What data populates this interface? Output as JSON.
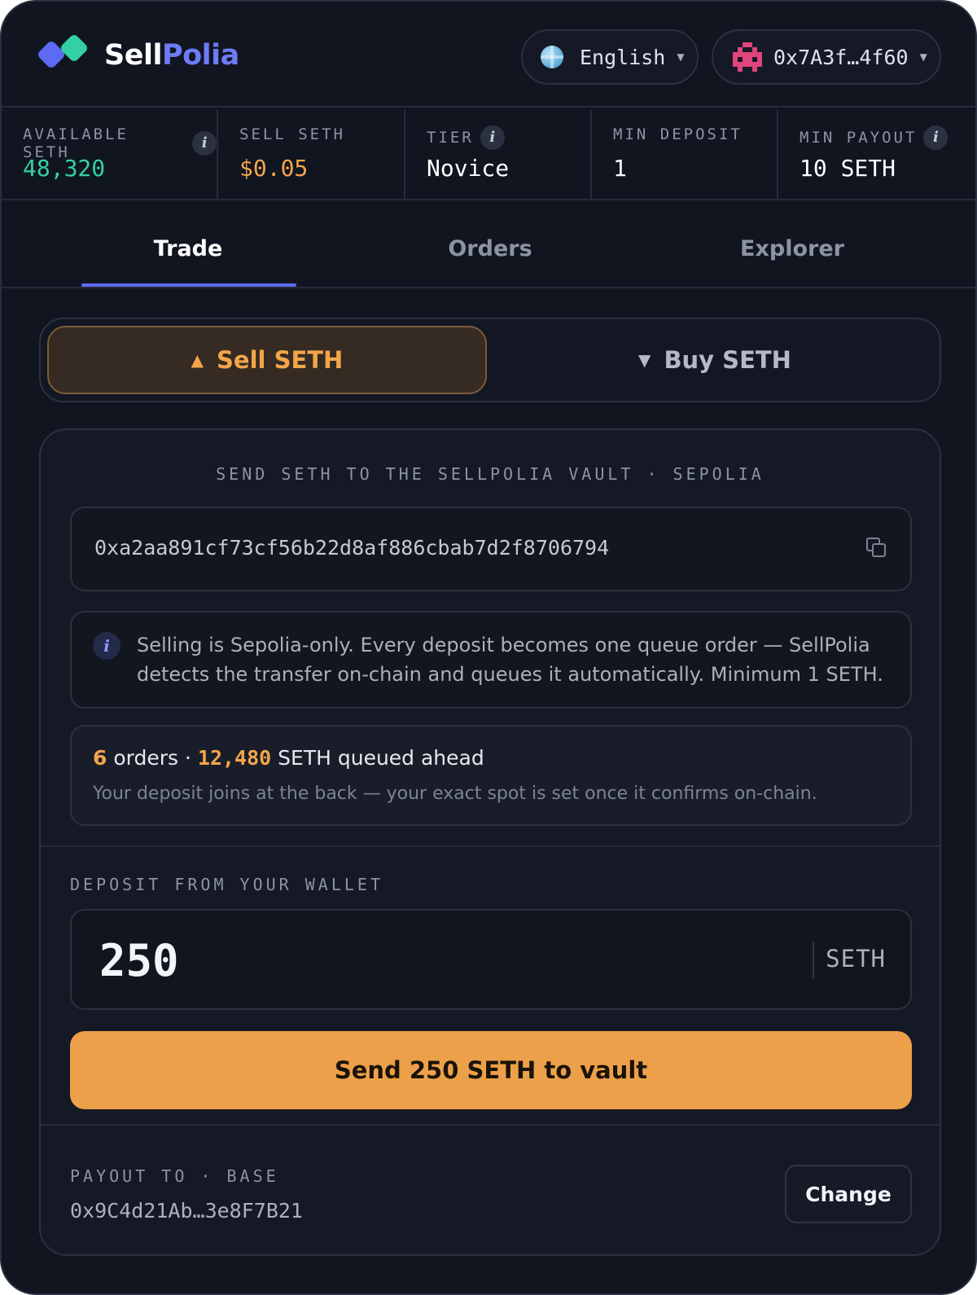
{
  "brand": {
    "part1": "Sell",
    "part2": "Polia"
  },
  "header": {
    "language": "English",
    "wallet_address": "0x7A3f…4f60"
  },
  "stats": [
    {
      "label": "AVAILABLE SETH",
      "value": "48,320",
      "has_info": true,
      "color": "#34d0a4"
    },
    {
      "label": "SELL SETH",
      "value": "$0.05",
      "has_info": false,
      "color": "#f3a54a"
    },
    {
      "label": "TIER",
      "value": "Novice",
      "has_info": true,
      "color": "#ffffff"
    },
    {
      "label": "MIN DEPOSIT",
      "value": "1",
      "has_info": false,
      "color": "#ffffff"
    },
    {
      "label": "MIN PAYOUT",
      "value": "10 SETH",
      "has_info": true,
      "color": "#ffffff"
    }
  ],
  "tabs": [
    {
      "label": "Trade",
      "active": true
    },
    {
      "label": "Orders",
      "active": false
    },
    {
      "label": "Explorer",
      "active": false
    }
  ],
  "toggle": {
    "sell_label": "Sell SETH",
    "buy_label": "Buy SETH",
    "active": "sell"
  },
  "vault": {
    "title": "SEND SETH TO THE SELLPOLIA VAULT · SEPOLIA",
    "address": "0xa2aa891cf73cf56b22d8af886cbab7d2f8706794"
  },
  "note": {
    "icon": "i",
    "text": "Selling is Sepolia-only. Every deposit becomes one queue order — SellPolia detects the transfer on-chain and queues it automatically. Minimum 1 SETH."
  },
  "queue": {
    "orders_count": "6",
    "orders_word": "orders ·",
    "amount": "12,480",
    "amount_suffix": "SETH queued ahead",
    "sub": "Your deposit joins at the back — your exact spot is set once it confirms on-chain."
  },
  "deposit": {
    "label": "DEPOSIT FROM YOUR WALLET",
    "amount": "250",
    "unit": "SETH",
    "send_label": "Send 250 SETH to vault"
  },
  "payout": {
    "label": "PAYOUT TO · BASE",
    "address": "0x9C4d21Ab…3e8F7B21",
    "change_label": "Change"
  },
  "colors": {
    "background": "#111520",
    "accent": "#5d6bf2",
    "sell": "#f3a54a",
    "positive": "#34d0a4"
  },
  "icons": {
    "logo": "diamond-pair-logo",
    "language": "globe-icon",
    "wallet": "pixel-avatar-icon",
    "copy": "copy-icon",
    "info": "info-icon",
    "caret": "chevron-down-icon"
  }
}
